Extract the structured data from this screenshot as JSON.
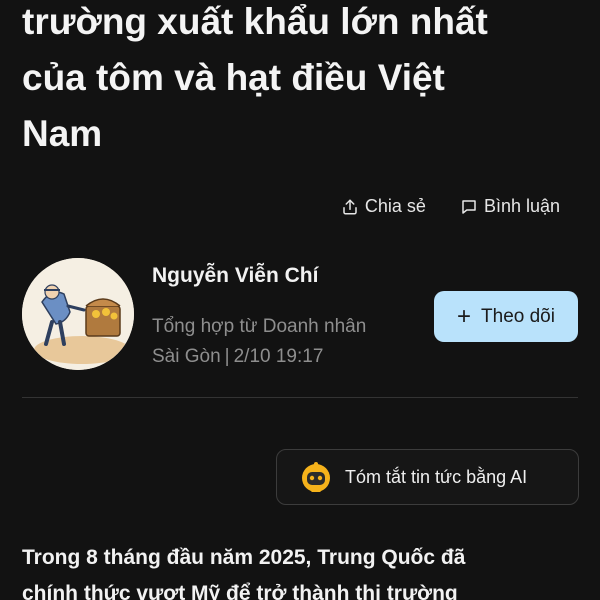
{
  "article": {
    "title_line1": "trường xuất khẩu lớn nhất",
    "title_line2": "của tôm và hạt điều Việt",
    "title_line3": "Nam",
    "body_line1": "Trong 8 tháng đầu năm 2025, Trung Quốc đã",
    "body_line2": "chính thức vượt Mỹ để trở thành thị trường"
  },
  "actions": {
    "share_label": "Chia sẻ",
    "comment_label": "Bình luận",
    "share_icon": "share-icon",
    "comment_icon": "comment-icon"
  },
  "author": {
    "name": "Nguyễn Viễn Chí",
    "source_line1": "Tổng hợp từ Doanh nhân",
    "source_line2": "Sài Gòn",
    "separator": "|",
    "timestamp": "2/10 19:17"
  },
  "follow": {
    "plus": "+",
    "label": "Theo dõi",
    "color": "#b9e2fb"
  },
  "ai_summary": {
    "label": "Tóm tắt tin tức bằng AI",
    "icon": "ai-bot-icon",
    "icon_color": "#f5b21b"
  },
  "colors": {
    "background": "#121212",
    "text": "#f2f2f2",
    "muted": "#8e8e8e"
  }
}
